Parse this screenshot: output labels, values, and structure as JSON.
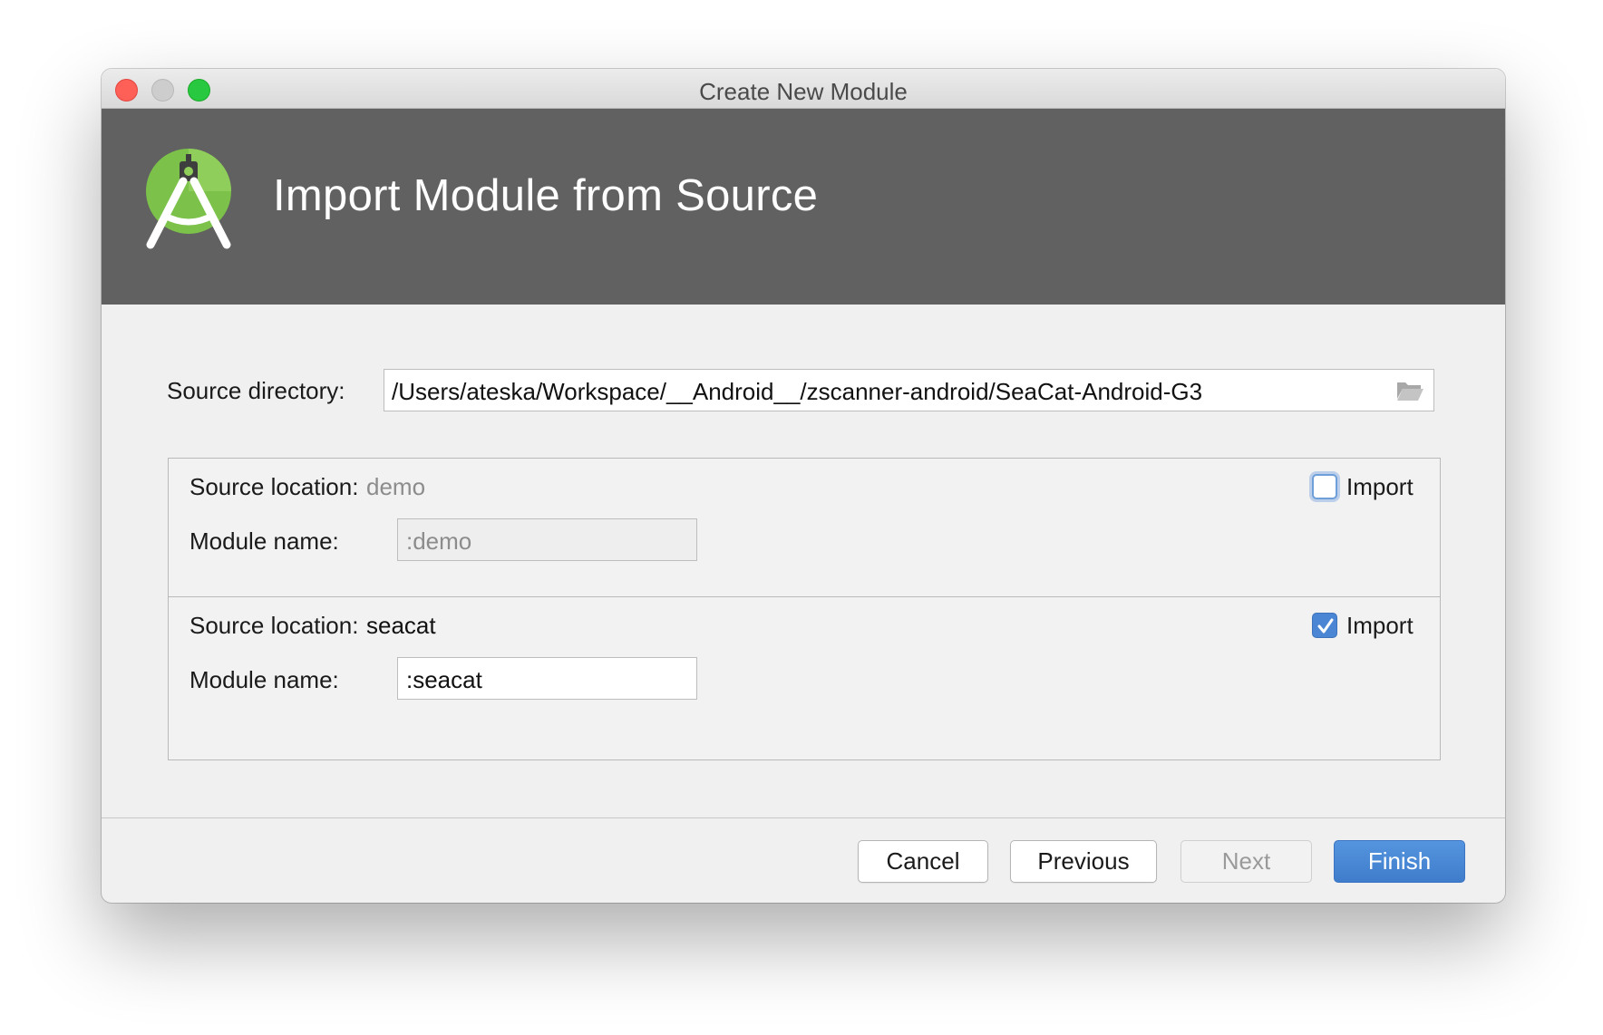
{
  "window": {
    "title": "Create New Module"
  },
  "header": {
    "title": "Import Module from Source",
    "logo_icon": "android-studio-logo-icon"
  },
  "source_directory": {
    "label": "Source directory:",
    "value": "/Users/ateska/Workspace/__Android__/zscanner-android/SeaCat-Android-G3",
    "browse_icon": "folder-open-icon"
  },
  "modules": [
    {
      "location_label": "Source location:",
      "location_value": "demo",
      "name_label": "Module name:",
      "name_value": ":demo",
      "import_label": "Import",
      "import_checked": false
    },
    {
      "location_label": "Source location:",
      "location_value": "seacat",
      "name_label": "Module name:",
      "name_value": ":seacat",
      "import_label": "Import",
      "import_checked": true
    }
  ],
  "buttons": {
    "cancel": "Cancel",
    "previous": "Previous",
    "next": "Next",
    "finish": "Finish"
  },
  "colors": {
    "header_bg": "#616161",
    "accent": "#4a86d4",
    "logo_green": "#7cc24a"
  }
}
